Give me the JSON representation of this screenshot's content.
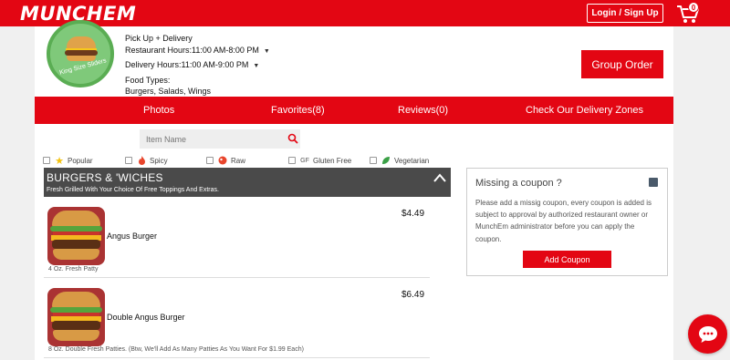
{
  "header": {
    "logo": "MUNCHEM",
    "login_label": "Login / Sign Up",
    "cart_count": "0"
  },
  "restaurant": {
    "logo_text": "King Size Sliders",
    "service": "Pick Up + Delivery",
    "restaurant_hours": "Restaurant Hours:11:00 AM-8:00 PM",
    "delivery_hours": "Delivery Hours:11:00 AM-9:00 PM",
    "food_types_label": "Food Types:",
    "food_types": "Burgers, Salads, Wings",
    "group_order_label": "Group Order"
  },
  "nav": {
    "items": [
      "Photos",
      "Favorites(8)",
      "Reviews(0)",
      "Check Our Delivery Zones"
    ]
  },
  "search": {
    "placeholder": "Item Name"
  },
  "filters": [
    {
      "label": "Popular",
      "icon": "star-icon"
    },
    {
      "label": "Spicy",
      "icon": "flame-icon"
    },
    {
      "label": "Raw",
      "icon": "raw-icon"
    },
    {
      "label": "Gluten Free",
      "icon": "gluten-free-icon"
    },
    {
      "label": "Vegetarian",
      "icon": "leaf-icon"
    }
  ],
  "category": {
    "title": "BURGERS & 'WICHES",
    "subtitle": "Fresh Grilled With Your Choice Of Free Toppings And Extras."
  },
  "items": [
    {
      "name": "Angus Burger",
      "price": "$4.49",
      "description": "4 Oz. Fresh Patty"
    },
    {
      "name": "Double Angus Burger",
      "price": "$6.49",
      "description": "8 Oz. Double Fresh Patties. (Btw, We'll Add As Many Patties As You Want For $1.99 Each)"
    }
  ],
  "coupon": {
    "title": "Missing a coupon ?",
    "body": "Please add a missig coupon, every coupon is added is subject to approval by authorized restaurant owner or MunchEm administrator before you can apply the coupon.",
    "button_label": "Add Coupon"
  },
  "colors": {
    "brand_red": "#e30613",
    "category_bg": "#4a4a4a"
  }
}
